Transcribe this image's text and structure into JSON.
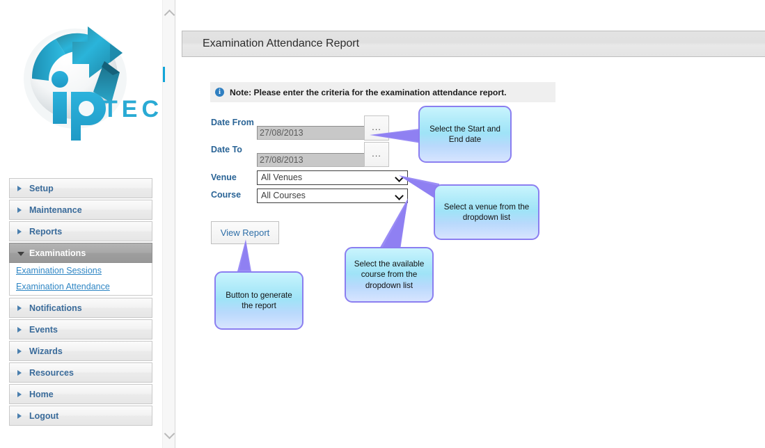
{
  "brand": {
    "name": "iP TECH",
    "word_mark": "TECH",
    "colors": {
      "primary": "#29aad4",
      "dark": "#1b6b84"
    }
  },
  "sidebar": {
    "items": [
      {
        "label": "Setup",
        "icon": "triangle-right-icon",
        "state": "collapsed"
      },
      {
        "label": "Maintenance",
        "icon": "triangle-right-icon",
        "state": "collapsed"
      },
      {
        "label": "Reports",
        "icon": "triangle-right-icon",
        "state": "collapsed"
      },
      {
        "label": "Examinations",
        "icon": "triangle-down-icon",
        "state": "expanded"
      },
      {
        "label": "Notifications",
        "icon": "triangle-right-icon",
        "state": "collapsed"
      },
      {
        "label": "Events",
        "icon": "triangle-right-icon",
        "state": "collapsed"
      },
      {
        "label": "Wizards",
        "icon": "triangle-right-icon",
        "state": "collapsed"
      },
      {
        "label": "Resources",
        "icon": "triangle-right-icon",
        "state": "collapsed"
      },
      {
        "label": "Home",
        "icon": "triangle-right-icon",
        "state": "collapsed"
      },
      {
        "label": "Logout",
        "icon": "triangle-right-icon",
        "state": "collapsed"
      }
    ],
    "submenu": [
      {
        "label": "Examination Sessions"
      },
      {
        "label": "Examination Attendance"
      }
    ]
  },
  "scrollbar": {
    "up_icon": "chevron-up-icon",
    "down_icon": "chevron-down-icon"
  },
  "header": {
    "title": "Examination Attendance Report"
  },
  "note": {
    "icon": "info-icon",
    "icon_glyph": "i",
    "text": "Note: Please enter the criteria for the examination attendance report."
  },
  "form": {
    "date_from": {
      "label": "Date From",
      "value": "27/08/2013",
      "picker_label": "..."
    },
    "date_to": {
      "label": "Date To",
      "value": "27/08/2013",
      "picker_label": "..."
    },
    "venue": {
      "label": "Venue",
      "selected": "All Venues",
      "options": [
        "All Venues"
      ]
    },
    "course": {
      "label": "Course",
      "selected": "All Courses",
      "options": [
        "All Courses"
      ]
    },
    "view_report_label": "View Report"
  },
  "callouts": [
    {
      "id": "dates",
      "text": "Select the Start and End date"
    },
    {
      "id": "venue",
      "text": "Select a venue from the dropdown list"
    },
    {
      "id": "course",
      "text": "Select the available course from the dropdown list"
    },
    {
      "id": "button",
      "text": "Button to generate the report"
    }
  ],
  "colors": {
    "callout_border": "#8b7ef0",
    "callout_fill": "#a9e8f8",
    "link": "#2f86c4",
    "label": "#2a6496",
    "active_menu_text": "#ffffff"
  }
}
